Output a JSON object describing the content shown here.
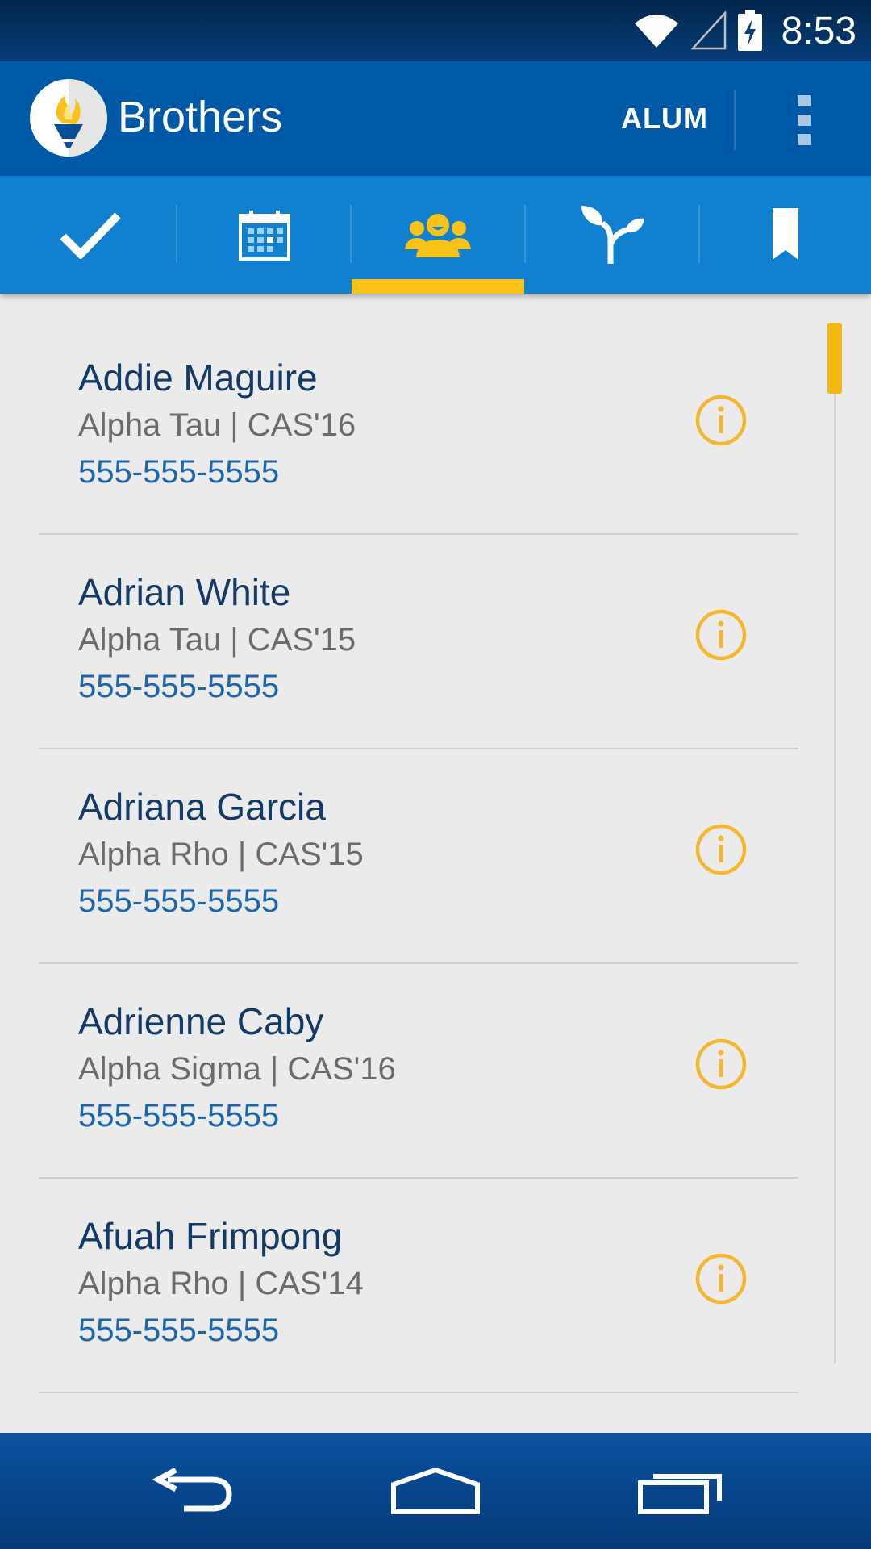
{
  "status_bar": {
    "time": "8:53"
  },
  "app_bar": {
    "title": "Brothers",
    "action_label": "ALUM"
  },
  "tabs": [
    {
      "icon": "check-icon",
      "selected": false
    },
    {
      "icon": "calendar-icon",
      "selected": false
    },
    {
      "icon": "people-icon",
      "selected": true
    },
    {
      "icon": "sprout-icon",
      "selected": false
    },
    {
      "icon": "bookmark-icon",
      "selected": false
    }
  ],
  "colors": {
    "primary": "#0059a6",
    "tab_bar": "#1080cf",
    "accent": "#f8c21a",
    "name_text": "#143a68",
    "phone_text": "#1c66ad"
  },
  "brothers": [
    {
      "name": "Addie Maguire",
      "chapter_class": "Alpha Tau | CAS'16",
      "phone": "555-555-5555"
    },
    {
      "name": "Adrian White",
      "chapter_class": "Alpha Tau | CAS'15",
      "phone": "555-555-5555"
    },
    {
      "name": "Adriana Garcia",
      "chapter_class": "Alpha Rho | CAS'15",
      "phone": "555-555-5555"
    },
    {
      "name": "Adrienne Caby",
      "chapter_class": "Alpha Sigma | CAS'16",
      "phone": "555-555-5555"
    },
    {
      "name": "Afuah Frimpong",
      "chapter_class": "Alpha Rho | CAS'14",
      "phone": "555-555-5555"
    }
  ]
}
